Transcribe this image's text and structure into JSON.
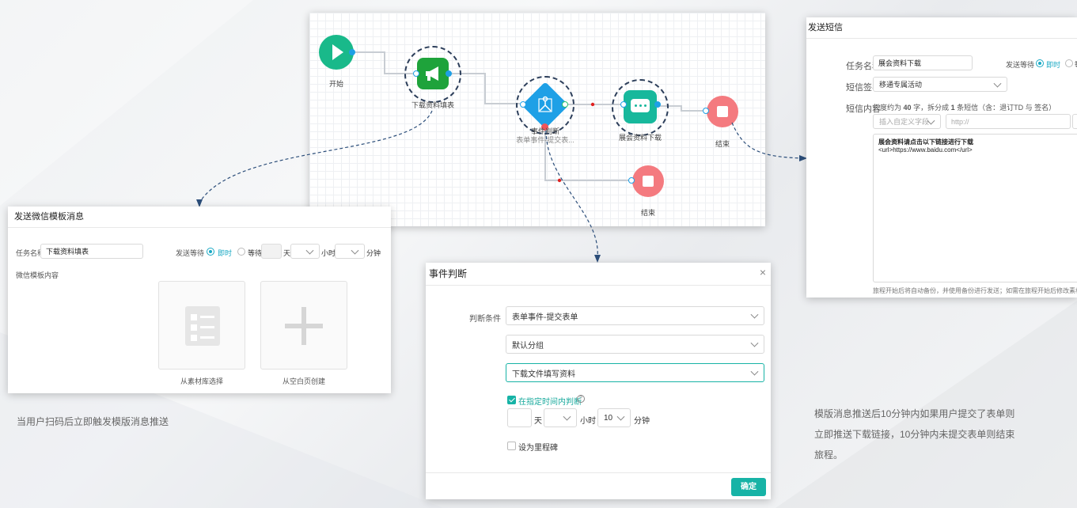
{
  "flow": {
    "start_label": "开始",
    "node_wechat_label": "下载资料填表",
    "node_event_label": "事件判断",
    "node_event_sub": "表单事件-提交表...",
    "node_sms_label": "展会资料下载",
    "end_label_1": "结束",
    "end_label_2": "结束"
  },
  "sms": {
    "title": "发送短信",
    "task_name_label": "任务名称",
    "task_name_value": "展会资料下载",
    "send_wait_label": "发送等待",
    "instant_label": "即时",
    "wait_label": "等",
    "sign_label": "短信签名",
    "sign_value": "移通专属活动",
    "content_label": "短信内容",
    "content_hint_prefix": "长度约为",
    "content_len": "40",
    "content_hint_mid": "字，拆分成",
    "content_parts": "1",
    "content_hint_suffix": "条短信（含：退订TD 与 签名）",
    "insert_field_placeholder": "插入自定义字段",
    "url_placeholder": "http://",
    "content_line1": "展会资料请点击以下链接进行下载",
    "content_line2": "<url>https://www.baidu.com</url>",
    "footer_note": "旅程开始后将自动备份，并使用备份进行发送；如需在旅程开始后修改素材，请先"
  },
  "wechat": {
    "title": "发送微信模板消息",
    "task_name_label": "任务名称",
    "task_name_value": "下载资料填表",
    "send_wait_label": "发送等待",
    "instant_label": "即时",
    "wait_label": "等待",
    "day_label": "天",
    "hour_label": "小时",
    "minute_label": "分钟",
    "template_label": "微信模板内容",
    "choose_library": "从素材库选择",
    "create_blank": "从空白页创建"
  },
  "event": {
    "title": "事件判断",
    "condition_label": "判断条件",
    "condition_value": "表单事件-提交表单",
    "group_value": "默认分组",
    "form_value": "下载文件填写资料",
    "within_time_label": "在指定时间内判断",
    "day_label": "天",
    "hour_label": "小时",
    "hour_value": "10",
    "minute_label": "分钟",
    "milestone_label": "设为里程碑",
    "confirm_label": "确定"
  },
  "captions": {
    "left": "当用户扫码后立即触发模版消息推送",
    "right_line1": "模版消息推送后10分钟内如果用户提交了表单则",
    "right_line2": "立即推送下载链接，10分钟内未提交表单则结束",
    "right_line3": "旅程。"
  },
  "colors": {
    "accent": "#17b3a6",
    "blue": "#1ea0e6",
    "start_green": "#19b98a",
    "end_red": "#f47a7f",
    "wechat_green": "#1ea33b"
  }
}
